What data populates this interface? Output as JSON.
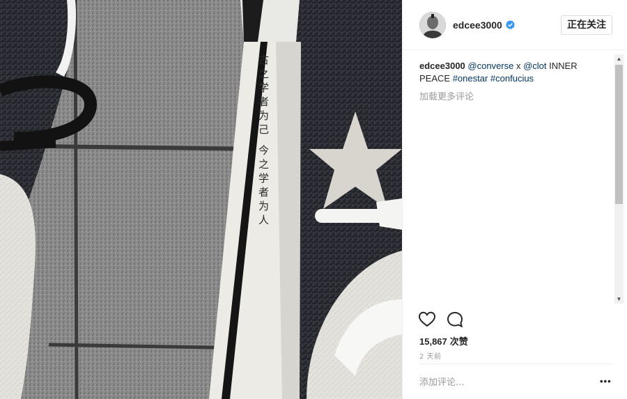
{
  "post": {
    "author": {
      "username": "edcee3000",
      "verified": true,
      "follow_status_label": "正在关注"
    },
    "caption": {
      "username": "edcee3000",
      "mention_1": "@converse",
      "joiner": " x ",
      "mention_2": "@clot",
      "text": " INNER PEACE ",
      "hashtag_1": "#onestar",
      "hashtag_2": "#confucius"
    },
    "load_more_label": "加载更多评论",
    "likes_count": "15,867",
    "likes_unit": "次赞",
    "timestamp": "2 天前",
    "comment_placeholder": "添加评论...",
    "more_options_label": "•••",
    "photo_text": "古之学者为己 今之学者为人"
  },
  "icons": {
    "like": "heart-outline-icon",
    "comment": "speech-bubble-icon",
    "verified": "verified-badge-icon",
    "more": "ellipsis-icon"
  },
  "colors": {
    "verified_blue": "#3897f0",
    "link": "#003569",
    "muted": "#999999",
    "text": "#262626"
  }
}
